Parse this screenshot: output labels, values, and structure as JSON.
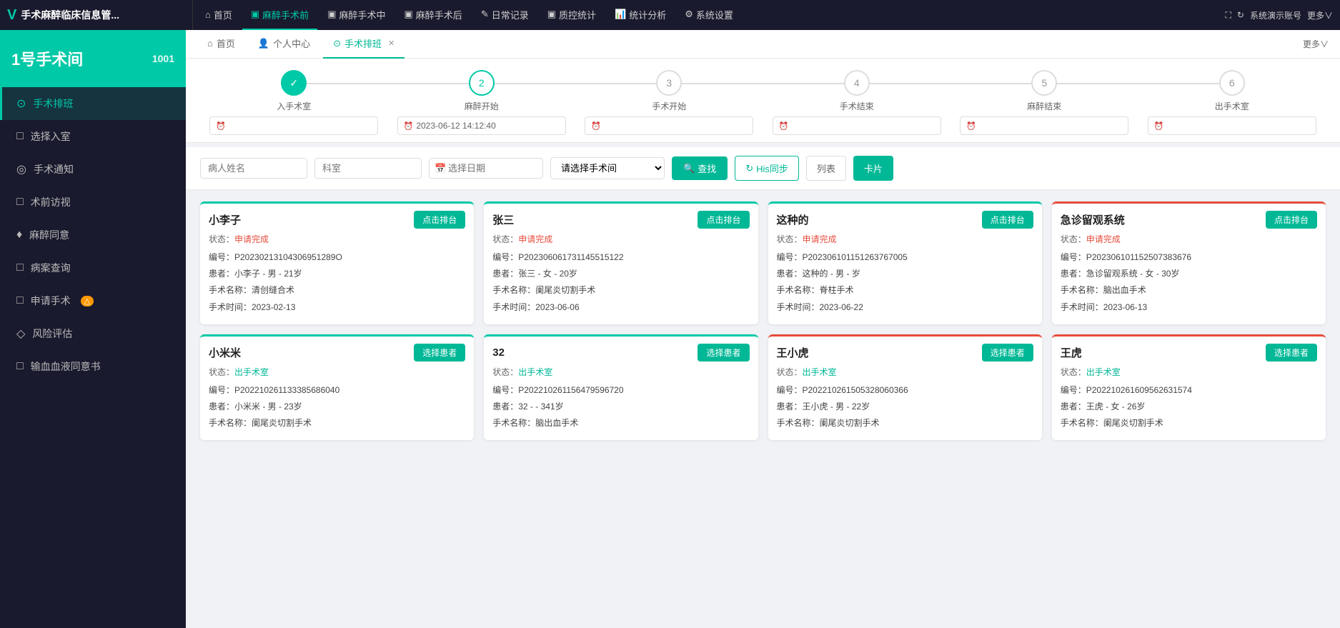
{
  "app": {
    "title": "手术麻醉临床信息管...",
    "logo": "V",
    "room_label": "1号手术间",
    "room_id": "1001",
    "system_demo": "系统演示账号"
  },
  "top_nav": {
    "items": [
      {
        "id": "home",
        "label": "首页",
        "icon": "⌂",
        "active": false
      },
      {
        "id": "pre-anesthesia",
        "label": "麻醉手术前",
        "icon": "▣",
        "active": true
      },
      {
        "id": "during-surgery",
        "label": "麻醉手术中",
        "icon": "▣",
        "active": false
      },
      {
        "id": "post-anesthesia",
        "label": "麻醉手术后",
        "icon": "▣",
        "active": false
      },
      {
        "id": "daily-records",
        "label": "日常记录",
        "icon": "✎",
        "active": false
      },
      {
        "id": "quality-control",
        "label": "质控统计",
        "icon": "▣",
        "active": false
      },
      {
        "id": "stats-analysis",
        "label": "统计分析",
        "icon": "📊",
        "active": false
      },
      {
        "id": "system-settings",
        "label": "系统设置",
        "icon": "⚙",
        "active": false
      }
    ],
    "expand_icon": "⛶",
    "more_label": "更多∨"
  },
  "tabs": [
    {
      "id": "home",
      "label": "首页",
      "icon": "⌂",
      "closable": false,
      "active": false
    },
    {
      "id": "personal",
      "label": "个人中心",
      "icon": "👤",
      "closable": false,
      "active": false
    },
    {
      "id": "surgery-schedule",
      "label": "手术排班",
      "icon": "⊙",
      "closable": true,
      "active": true
    }
  ],
  "steps": [
    {
      "num": "✓",
      "label": "入手术室",
      "done": true,
      "time": ""
    },
    {
      "num": "2",
      "label": "麻醉开始",
      "done": false,
      "time": "2023-06-12 14:12:40"
    },
    {
      "num": "3",
      "label": "手术开始",
      "done": false,
      "time": ""
    },
    {
      "num": "4",
      "label": "手术结束",
      "done": false,
      "time": ""
    },
    {
      "num": "5",
      "label": "麻醉结束",
      "done": false,
      "time": ""
    },
    {
      "num": "6",
      "label": "出手术室",
      "done": false,
      "time": ""
    }
  ],
  "filter": {
    "patient_name_placeholder": "病人姓名",
    "department_placeholder": "科室",
    "date_placeholder": "选择日期",
    "room_placeholder": "请选择手术间",
    "search_label": "查找",
    "his_sync_label": "His同步",
    "list_label": "列表",
    "card_label": "卡片"
  },
  "sidebar": {
    "items": [
      {
        "id": "surgery-schedule",
        "icon": "⊙",
        "label": "手术排班",
        "active": true,
        "badge": null
      },
      {
        "id": "select-entry",
        "icon": "□",
        "label": "选择入室",
        "active": false,
        "badge": null
      },
      {
        "id": "surgery-notice",
        "icon": "◎",
        "label": "手术通知",
        "active": false,
        "badge": null
      },
      {
        "id": "preop-visit",
        "icon": "□",
        "label": "术前访视",
        "active": false,
        "badge": null
      },
      {
        "id": "anesthesia-consent",
        "icon": "♦",
        "label": "麻醉同意",
        "active": false,
        "badge": null
      },
      {
        "id": "case-query",
        "icon": "□",
        "label": "病案查询",
        "active": false,
        "badge": null
      },
      {
        "id": "apply-surgery",
        "icon": "□",
        "label": "申请手术",
        "active": false,
        "badge": "△"
      },
      {
        "id": "risk-eval",
        "icon": "◇",
        "label": "风险评估",
        "active": false,
        "badge": null
      },
      {
        "id": "blood-consent",
        "icon": "□",
        "label": "输血血液同意书",
        "active": false,
        "badge": null
      }
    ]
  },
  "cards_row1": [
    {
      "id": "c1",
      "name": "小李子",
      "status_label": "状态：",
      "status": "申请完成",
      "status_type": "red",
      "border_type": "green-top",
      "btn_label": "点击排台",
      "code": "编号：P20230213104306951289O",
      "patient": "患者：小李子 - 男 - 21岁",
      "surgery_name": "手术名称：清创缝合术",
      "surgery_time": "手术时间：2023-02-13"
    },
    {
      "id": "c2",
      "name": "张三",
      "status_label": "状态：",
      "status": "申请完成",
      "status_type": "red",
      "border_type": "green-top",
      "btn_label": "点击排台",
      "code": "编号：P202306061731145515122",
      "patient": "患者：张三 - 女 - 20岁",
      "surgery_name": "手术名称：阑尾炎切割手术",
      "surgery_time": "手术时间：2023-06-06"
    },
    {
      "id": "c3",
      "name": "这种的",
      "status_label": "状态：",
      "status": "申请完成",
      "status_type": "red",
      "border_type": "green-top",
      "btn_label": "点击排台",
      "code": "编号：P202306101151263767005",
      "patient": "患者：这种的 - 男 - 岁",
      "surgery_name": "手术名称：脊柱手术",
      "surgery_time": "手术时间：2023-06-22"
    },
    {
      "id": "c4",
      "name": "急诊留观系统",
      "status_label": "状态：",
      "status": "申请完成",
      "status_type": "red",
      "border_type": "red-top",
      "btn_label": "点击排台",
      "code": "编号：P202306101152507383676",
      "patient": "患者：急诊留观系统 - 女 - 30岁",
      "surgery_name": "手术名称：脑出血手术",
      "surgery_time": "手术时间：2023-06-13"
    }
  ],
  "cards_row2": [
    {
      "id": "c5",
      "name": "小米米",
      "status_label": "状态：",
      "status": "出手术室",
      "status_type": "orange",
      "border_type": "green-top",
      "btn_label": "选择患者",
      "code": "编号：P202210261133385686040",
      "patient": "患者：小米米 - 男 - 23岁",
      "surgery_name": "手术名称：阑尾炎切割手术",
      "surgery_time": ""
    },
    {
      "id": "c6",
      "name": "32",
      "status_label": "状态：",
      "status": "出手术室",
      "status_type": "orange",
      "border_type": "green-top",
      "btn_label": "选择患者",
      "code": "编号：P202210261156479596720",
      "patient": "患者：32 - - 341岁",
      "surgery_name": "手术名称：脑出血手术",
      "surgery_time": ""
    },
    {
      "id": "c7",
      "name": "王小虎",
      "status_label": "状态：",
      "status": "出手术室",
      "status_type": "orange",
      "border_type": "red-top",
      "btn_label": "选择患者",
      "code": "编号：P202210261505328060366",
      "patient": "患者：王小虎 - 男 - 22岁",
      "surgery_name": "手术名称：阑尾炎切割手术",
      "surgery_time": ""
    },
    {
      "id": "c8",
      "name": "王虎",
      "status_label": "状态：",
      "status": "出手术室",
      "status_type": "orange",
      "border_type": "red-top",
      "btn_label": "选择患者",
      "code": "编号：P202210261609562631574",
      "patient": "患者：王虎 - 女 - 26岁",
      "surgery_name": "手术名称：阑尾炎切割手术",
      "surgery_time": ""
    }
  ]
}
